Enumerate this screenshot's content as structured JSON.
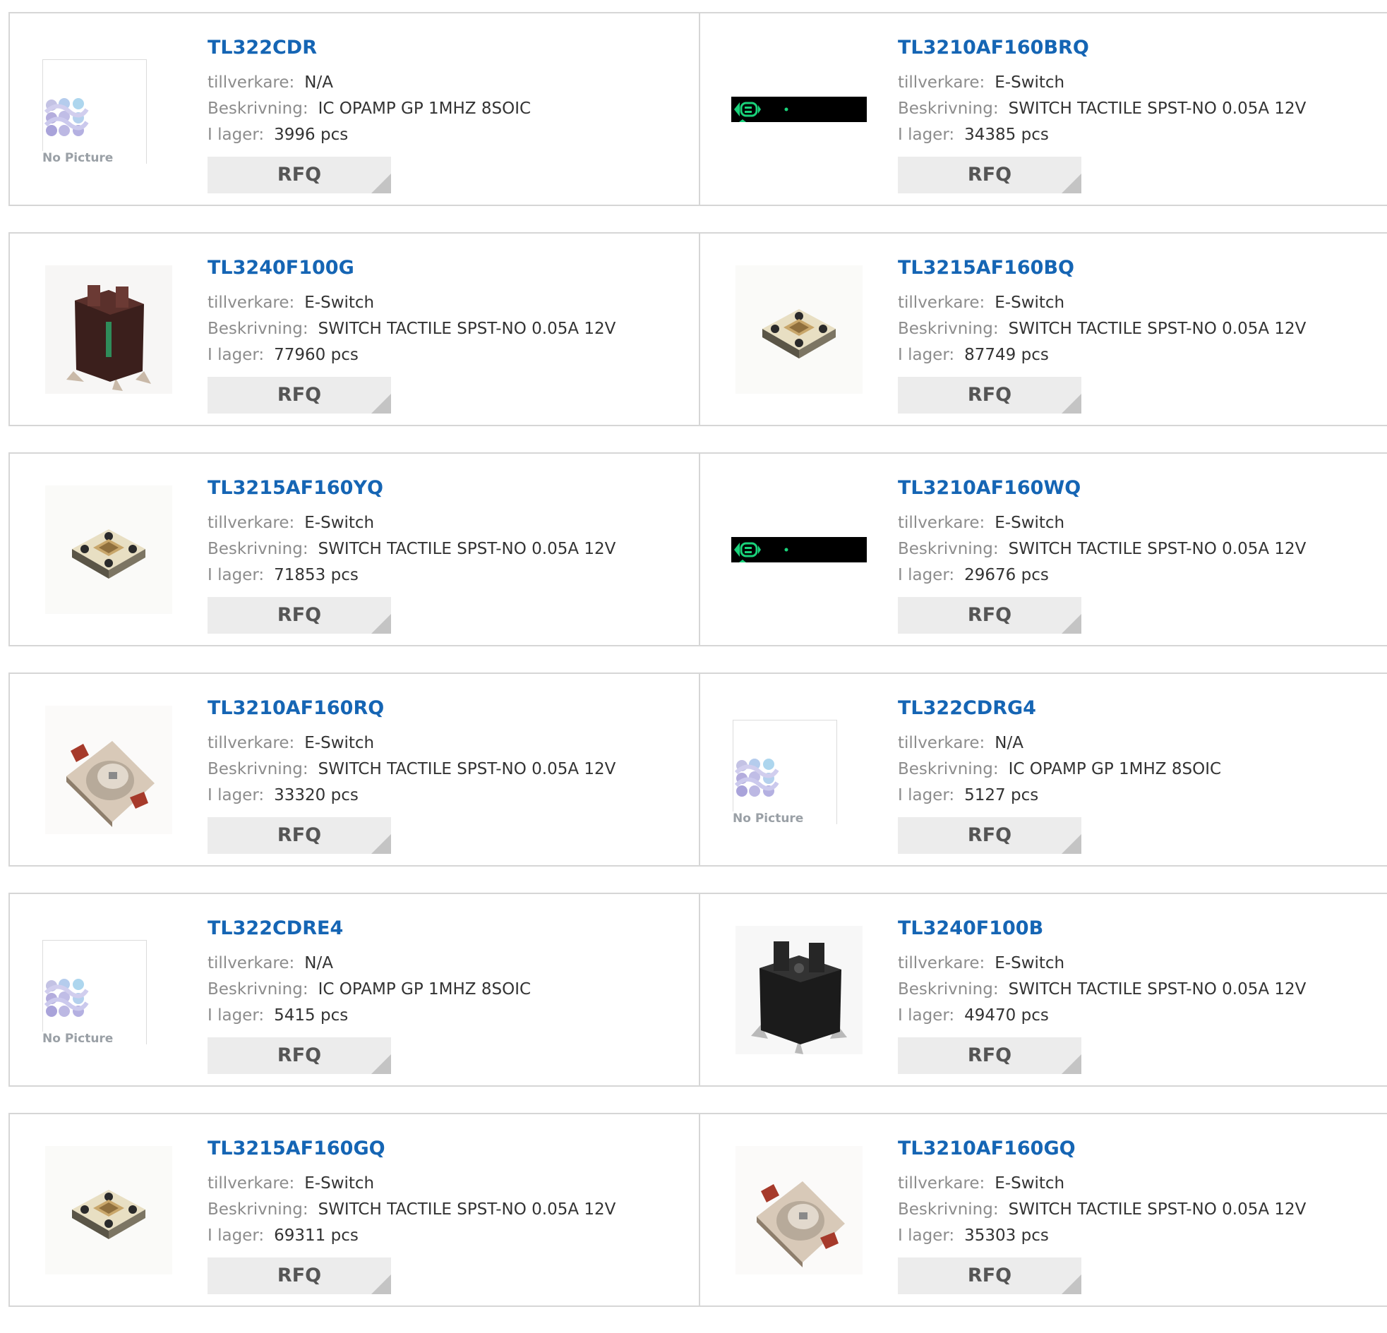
{
  "labels": {
    "manufacturer": "tillverkare:",
    "description": "Beskrivning:",
    "stock": "I lager:",
    "rfq": "RFQ",
    "no_picture": "No Picture"
  },
  "products": [
    {
      "pn": "TL322CDR",
      "manufacturer": "N/A",
      "description": "IC OPAMP GP 1MHZ 8SOIC",
      "stock": "3996 pcs",
      "image": "no-picture"
    },
    {
      "pn": "TL3210AF160BRQ",
      "manufacturer": "E-Switch",
      "description": "SWITCH TACTILE SPST-NO 0.05A 12V",
      "stock": "34385 pcs",
      "image": "led-display"
    },
    {
      "pn": "TL3240F100G",
      "manufacturer": "E-Switch",
      "description": "SWITCH TACTILE SPST-NO 0.05A 12V",
      "stock": "77960 pcs",
      "image": "brown-switch"
    },
    {
      "pn": "TL3215AF160BQ",
      "manufacturer": "E-Switch",
      "description": "SWITCH TACTILE SPST-NO 0.05A 12V",
      "stock": "87749 pcs",
      "image": "cream-switch"
    },
    {
      "pn": "TL3215AF160YQ",
      "manufacturer": "E-Switch",
      "description": "SWITCH TACTILE SPST-NO 0.05A 12V",
      "stock": "71853 pcs",
      "image": "cream-switch"
    },
    {
      "pn": "TL3210AF160WQ",
      "manufacturer": "E-Switch",
      "description": "SWITCH TACTILE SPST-NO 0.05A 12V",
      "stock": "29676 pcs",
      "image": "led-display"
    },
    {
      "pn": "TL3210AF160RQ",
      "manufacturer": "E-Switch",
      "description": "SWITCH TACTILE SPST-NO 0.05A 12V",
      "stock": "33320 pcs",
      "image": "red-switch"
    },
    {
      "pn": "TL322CDRG4",
      "manufacturer": "N/A",
      "description": "IC OPAMP GP 1MHZ 8SOIC",
      "stock": "5127 pcs",
      "image": "no-picture"
    },
    {
      "pn": "TL322CDRE4",
      "manufacturer": "N/A",
      "description": "IC OPAMP GP 1MHZ 8SOIC",
      "stock": "5415 pcs",
      "image": "no-picture"
    },
    {
      "pn": "TL3240F100B",
      "manufacturer": "E-Switch",
      "description": "SWITCH TACTILE SPST-NO 0.05A 12V",
      "stock": "49470 pcs",
      "image": "black-switch"
    },
    {
      "pn": "TL3215AF160GQ",
      "manufacturer": "E-Switch",
      "description": "SWITCH TACTILE SPST-NO 0.05A 12V",
      "stock": "69311 pcs",
      "image": "cream-switch"
    },
    {
      "pn": "TL3210AF160GQ",
      "manufacturer": "E-Switch",
      "description": "SWITCH TACTILE SPST-NO 0.05A 12V",
      "stock": "35303 pcs",
      "image": "red-switch"
    }
  ],
  "colors": {
    "part_number": "#1565b4",
    "label": "#8c8c8c",
    "value": "#333333",
    "rfq_bg": "#ececec",
    "border": "#d6d6d6"
  }
}
